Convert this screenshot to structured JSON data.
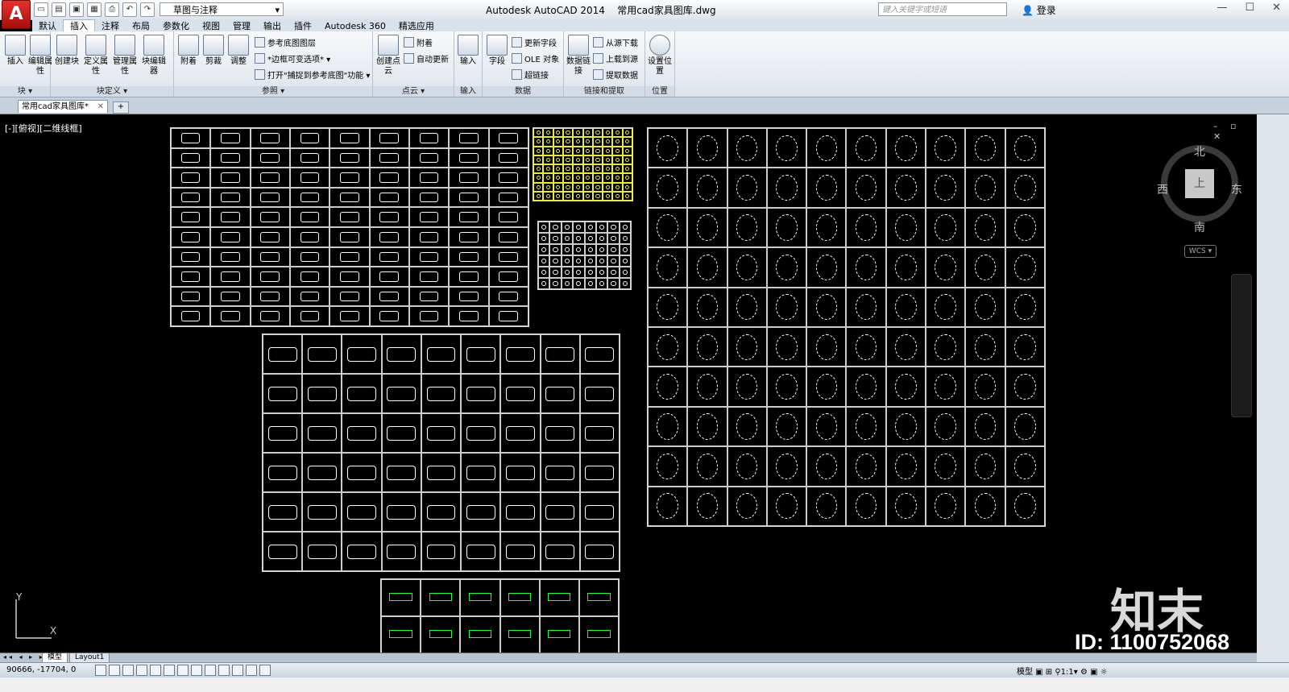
{
  "app": {
    "title": "Autodesk AutoCAD 2014",
    "file": "常用cad家具图库.dwg",
    "logo": "A",
    "workspace": "草图与注释",
    "search_placeholder": "键入关键字或短语",
    "login": "登录",
    "window_buttons": [
      "—",
      "☐",
      "✕"
    ]
  },
  "menu": [
    "默认",
    "插入",
    "注释",
    "布局",
    "参数化",
    "视图",
    "管理",
    "输出",
    "插件",
    "Autodesk 360",
    "精选应用"
  ],
  "menu_active": "插入",
  "ribbon": {
    "panels": [
      {
        "title": "块 ▾",
        "buttons": [
          "插入",
          "编辑属性"
        ]
      },
      {
        "title": "块定义 ▾",
        "buttons": [
          "创建块",
          "定义属性",
          "管理属性",
          "块编辑器"
        ]
      },
      {
        "title": "参照 ▾",
        "buttons": [
          "附着",
          "剪裁",
          "调整"
        ],
        "small": [
          "参考底图图层",
          "*边框可变选项* ▾",
          "打开\"捕捉到参考底图\"功能 ▾"
        ]
      },
      {
        "title": "点云 ▾",
        "buttons": [
          "创建点云"
        ],
        "small": [
          "附着",
          "自动更新"
        ]
      },
      {
        "title": "输入",
        "buttons": [
          "输入"
        ]
      },
      {
        "title": "数据",
        "buttons": [
          "字段"
        ],
        "small": [
          "更新字段",
          "OLE 对象",
          "超链接"
        ]
      },
      {
        "title": "链接和提取",
        "buttons": [
          "数据链接"
        ],
        "small": [
          "从源下载",
          "上载到源",
          "提取数据"
        ]
      },
      {
        "title": "位置",
        "buttons": [
          "设置位置"
        ]
      }
    ]
  },
  "doc_tab": {
    "label": "常用cad家具图库*",
    "close": "✕"
  },
  "viewport": {
    "label": "[-][俯视][二维线框]",
    "compass": {
      "north": "北",
      "south": "南",
      "east": "东",
      "west": "西",
      "face": "上",
      "wcs": "WCS ▾"
    },
    "controls": "– ▫ ✕",
    "ucs_x": "X",
    "ucs_y": "Y"
  },
  "watermark": {
    "brand": "知末",
    "id": "ID: 1100752068"
  },
  "layout_tabs": {
    "nav": "◂◂ ◂ ▸ ▸▸",
    "tabs": [
      "模型",
      "Layout1"
    ]
  },
  "status": {
    "coords": "90666, -17704, 0",
    "right": "模型 ▣ ⊞ ⚲1:1▾ ⚙ ▣ ☼"
  }
}
